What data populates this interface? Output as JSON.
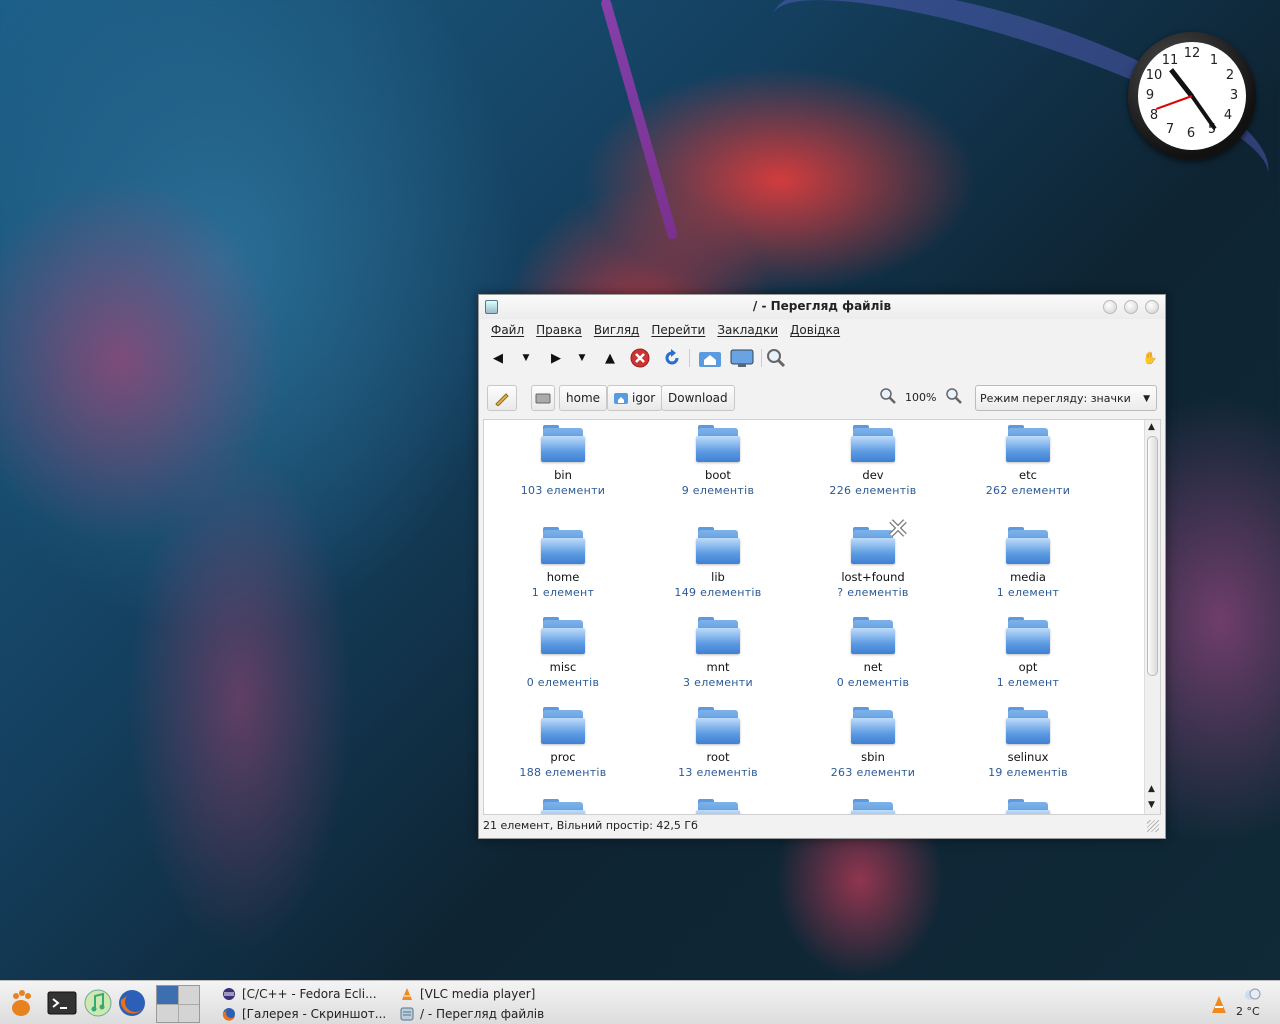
{
  "window": {
    "title": "/ - Перегляд файлів",
    "menu": [
      "Файл",
      "Правка",
      "Вигляд",
      "Перейти",
      "Закладки",
      "Довідка"
    ],
    "breadcrumbs": [
      "home",
      "igor",
      "Download"
    ],
    "zoom": "100%",
    "view_mode": "Режим перегляду: значки",
    "items": [
      {
        "name": "bin",
        "count": "103 елементи"
      },
      {
        "name": "boot",
        "count": "9 елементів"
      },
      {
        "name": "dev",
        "count": "226 елементів"
      },
      {
        "name": "etc",
        "count": "262 елементи"
      },
      {
        "name": "home",
        "count": "1 елемент"
      },
      {
        "name": "lib",
        "count": "149 елементів"
      },
      {
        "name": "lost+found",
        "count": "? елементів"
      },
      {
        "name": "media",
        "count": "1 елемент"
      },
      {
        "name": "misc",
        "count": "0 елементів"
      },
      {
        "name": "mnt",
        "count": "3 елементи"
      },
      {
        "name": "net",
        "count": "0 елементів"
      },
      {
        "name": "opt",
        "count": "1 елемент"
      },
      {
        "name": "proc",
        "count": "188 елементів"
      },
      {
        "name": "root",
        "count": "13 елементів"
      },
      {
        "name": "sbin",
        "count": "263 елементи"
      },
      {
        "name": "selinux",
        "count": "19 елементів"
      }
    ],
    "status": "21 елемент, Вільний простір: 42,5 Гб"
  },
  "clock": {
    "numerals": [
      "12",
      "1",
      "2",
      "3",
      "4",
      "5",
      "6",
      "7",
      "8",
      "9",
      "10",
      "11"
    ]
  },
  "taskbar": {
    "tasks": [
      {
        "label": "[C/C++ - Fedora Ecli...",
        "icon": "eclipse-icon"
      },
      {
        "label": "[Галерея - Скриншот...",
        "icon": "firefox-icon"
      },
      {
        "label": "[VLC media player]",
        "icon": "vlc-icon"
      },
      {
        "label": "/ - Перегляд файлів",
        "icon": "file-manager-icon"
      }
    ],
    "temperature": "2 °C"
  }
}
